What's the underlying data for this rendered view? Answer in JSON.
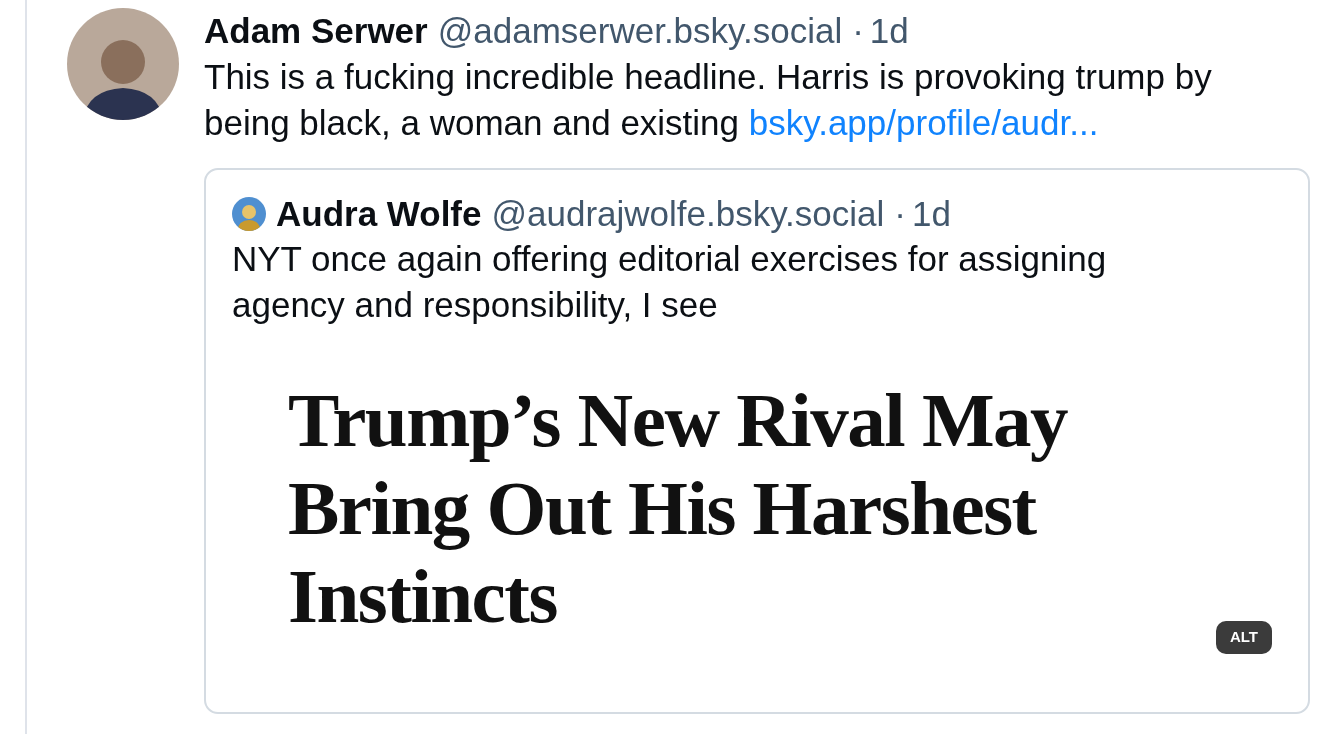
{
  "post": {
    "author": "Adam Serwer",
    "handle": "@adamserwer.bsky.social",
    "separator": "·",
    "time": "1d",
    "text": "This is a fucking incredible headline. Harris is provoking trump by being black, a woman and existing",
    "link": "bsky.app/profile/audr...",
    "quote": {
      "author": "Audra Wolfe",
      "handle": "@audrajwolfe.bsky.social",
      "separator": "·",
      "time": "1d",
      "text": "NYT once again offering editorial exercises for assigning agency and responsibility, I see",
      "image": {
        "headline_lines": [
          "Trump’s New Rival May",
          "Bring Out His Harshest",
          "Instincts"
        ],
        "badge": "ALT"
      }
    }
  }
}
